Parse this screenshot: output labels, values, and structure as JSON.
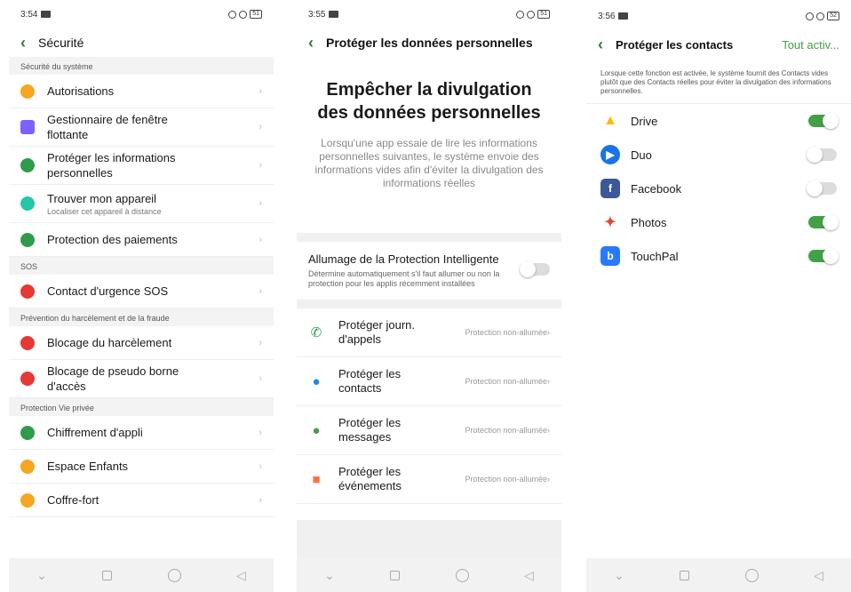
{
  "screen1": {
    "status_time": "3:54",
    "battery": "51",
    "title": "Sécurité",
    "sections": [
      {
        "header": "Sécurité du système",
        "items": [
          {
            "label": "Autorisations",
            "sub": "",
            "icon": "shield-icon",
            "color": "#f5a623"
          },
          {
            "label": "Gestionnaire de fenêtre flottante",
            "sub": "",
            "icon": "window-icon",
            "color": "#7b61ff"
          },
          {
            "label": "Protéger les informations personnelles",
            "sub": "",
            "icon": "shield-user-icon",
            "color": "#2e9c4a"
          },
          {
            "label": "Trouver mon appareil",
            "sub": "Localiser cet appareil à distance",
            "icon": "locate-icon",
            "color": "#26c6a8"
          },
          {
            "label": "Protection des paiements",
            "sub": "",
            "icon": "shield-dollar-icon",
            "color": "#2e9c4a"
          }
        ]
      },
      {
        "header": "SOS",
        "items": [
          {
            "label": "Contact d'urgence SOS",
            "sub": "",
            "icon": "sos-icon",
            "color": "#e53935"
          }
        ]
      },
      {
        "header": "Prévention du harcèlement et de la fraude",
        "items": [
          {
            "label": "Blocage du harcèlement",
            "sub": "",
            "icon": "block-icon",
            "color": "#e53935"
          },
          {
            "label": "Blocage de pseudo borne d'accès",
            "sub": "",
            "icon": "hotspot-icon",
            "color": "#e53935"
          }
        ]
      },
      {
        "header": "Protection Vie privée",
        "items": [
          {
            "label": "Chiffrement d'appli",
            "sub": "",
            "icon": "lock-icon",
            "color": "#2e9c4a"
          },
          {
            "label": "Espace Enfants",
            "sub": "",
            "icon": "child-icon",
            "color": "#f5a623"
          },
          {
            "label": "Coffre-fort",
            "sub": "",
            "icon": "folder-lock-icon",
            "color": "#f5a623"
          }
        ]
      }
    ]
  },
  "screen2": {
    "status_time": "3:55",
    "battery": "51",
    "title": "Protéger les données personnelles",
    "hero_title": "Empêcher la divulgation des données personnelles",
    "hero_text": "Lorsqu'une app essaie de lire les informations personnelles suivantes, le système envoie des informations vides afin d'éviter la divulgation des informations réelles",
    "smart_title": "Allumage de la Protection Intelligente",
    "smart_sub": "Détermine automatiquement s'il faut allumer ou non la protection pour les applis récemment installées",
    "smart_on": false,
    "rows": [
      {
        "label": "Protéger journ. d'appels",
        "status": "Protection non-allumée",
        "icon": "phone-icon",
        "color": "#2e9c4a"
      },
      {
        "label": "Protéger les contacts",
        "status": "Protection non-allumée",
        "icon": "contact-icon",
        "color": "#1e88e5"
      },
      {
        "label": "Protéger les messages",
        "status": "Protection non-allumée",
        "icon": "message-icon",
        "color": "#43a047"
      },
      {
        "label": "Protéger les événements",
        "status": "Protection non-allumée",
        "icon": "calendar-icon",
        "color": "#ff7043"
      }
    ]
  },
  "screen3": {
    "status_time": "3:56",
    "battery": "52",
    "title": "Protéger les contacts",
    "action": "Tout activ...",
    "description": "Lorsque cette fonction est activée, le système fournit des Contacts vides plutôt que des Contacts réelles pour éviter la divulgation des informations personnelles.",
    "apps": [
      {
        "name": "Drive",
        "on": true,
        "icon": "drive-icon",
        "color": "#fbbc04"
      },
      {
        "name": "Duo",
        "on": false,
        "icon": "duo-icon",
        "color": "#1a73e8"
      },
      {
        "name": "Facebook",
        "on": false,
        "icon": "facebook-icon",
        "color": "#3b5998"
      },
      {
        "name": "Photos",
        "on": true,
        "icon": "photos-icon",
        "color": "#ea4335"
      },
      {
        "name": "TouchPal",
        "on": true,
        "icon": "touchpal-icon",
        "color": "#2979ff"
      }
    ]
  },
  "nav": {
    "back": "◁",
    "home": "",
    "recent": "",
    "down": "⌄"
  }
}
